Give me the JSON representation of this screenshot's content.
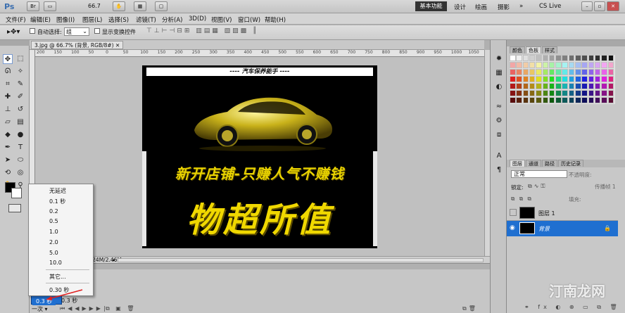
{
  "app": {
    "logo": "Ps",
    "zoom": "66.7",
    "workspace_active": "基本功能",
    "workspaces": [
      "设计",
      "绘画",
      "摄影"
    ],
    "cslive": "CS Live"
  },
  "menu": [
    "文件(F)",
    "编辑(E)",
    "图像(I)",
    "图层(L)",
    "选择(S)",
    "滤镜(T)",
    "分析(A)",
    "3D(D)",
    "视图(V)",
    "窗口(W)",
    "帮助(H)"
  ],
  "options": {
    "auto_select": "自动选择:",
    "auto_select_value": "组",
    "show_transform": "显示变换控件"
  },
  "document": {
    "tab_title": "3.jpg @ 66.7% (背景, RGB/8#)",
    "status": "1.24M/2.46M",
    "ruler_top": [
      "200",
      "150",
      "100",
      "50",
      "0",
      "50",
      "100",
      "150",
      "200",
      "250",
      "300",
      "350",
      "400",
      "450",
      "500",
      "550",
      "600",
      "650",
      "700",
      "750",
      "800",
      "850",
      "900",
      "950",
      "1000",
      "1050"
    ]
  },
  "poster": {
    "header": "---- 汽车保养能手 ----",
    "slogan": "新开店铺-只赚人气不赚钱",
    "title": "物超所值"
  },
  "dropdown": {
    "items": [
      "无延迟",
      "0.1 秒",
      "0.2",
      "0.5",
      "1.0",
      "2.0",
      "5.0",
      "10.0"
    ],
    "other": "其它...",
    "current": "0.30 秒"
  },
  "animation": {
    "frame_num": "1",
    "frame_delay": "0.3 秒",
    "loop": "一次",
    "delay2": "0.3 秒"
  },
  "swatches": {
    "tabs": [
      "颜色",
      "色板",
      "样式"
    ],
    "active": 1
  },
  "layers": {
    "tabs": [
      "图层",
      "通道",
      "路径",
      "历史记录"
    ],
    "blend": "正常",
    "opacity_label": "不透明度:",
    "lock_label": "锁定:",
    "fill_label": "填充:",
    "propagate": "传播帧 1",
    "rows": [
      {
        "name": "图层 1"
      },
      {
        "name": "背景"
      }
    ]
  },
  "watermark": "汀南龙网",
  "colors": {
    "accent": "#1f6fd0",
    "poster_bg": "#000000",
    "gold": "#e8d200"
  }
}
